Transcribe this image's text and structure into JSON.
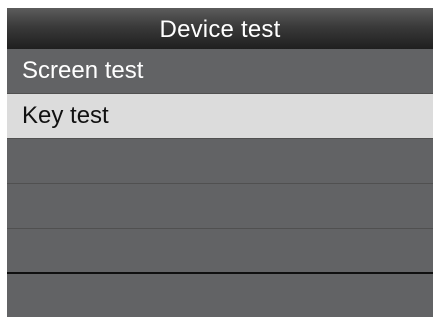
{
  "screen": {
    "title": "Device test",
    "menu_items": [
      {
        "label": "Screen test",
        "selected": false
      },
      {
        "label": "Key test",
        "selected": true
      },
      {
        "label": "",
        "selected": false
      },
      {
        "label": "",
        "selected": false
      },
      {
        "label": "",
        "selected": false
      },
      {
        "label": "",
        "selected": false
      }
    ]
  },
  "colors": {
    "background": "#626365",
    "title_bar": "#2b2b2b",
    "selected_row": "#dcdcdc",
    "text": "#ffffff",
    "selected_text": "#111111"
  }
}
